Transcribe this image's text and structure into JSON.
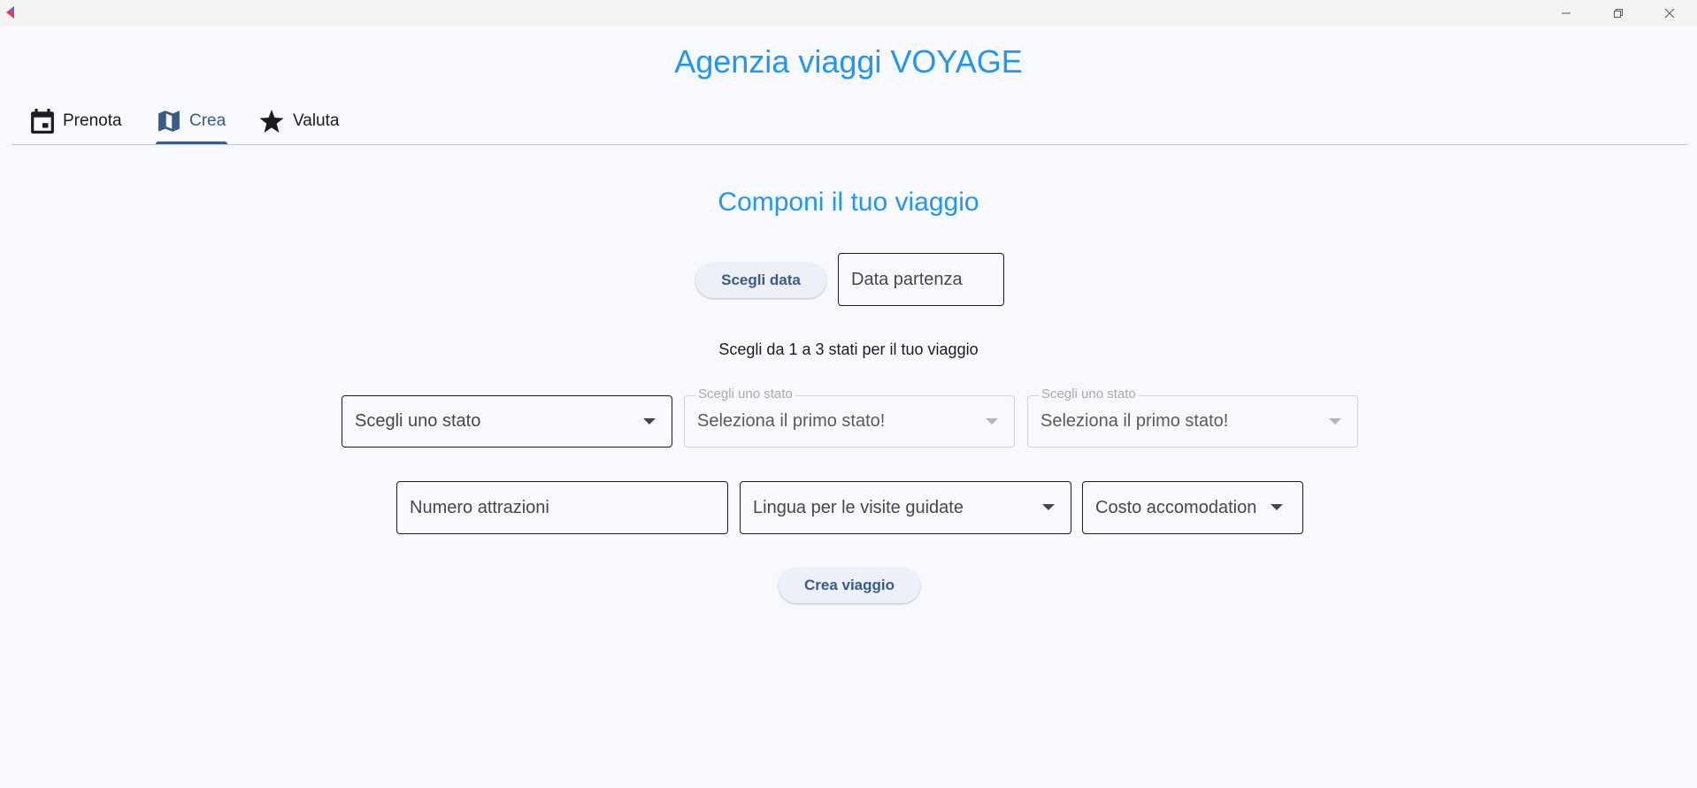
{
  "window": {
    "controls": {
      "minimize_icon": "minimize-icon",
      "maximize_icon": "restore-icon",
      "close_icon": "close-icon"
    }
  },
  "header": {
    "title": "Agenzia viaggi VOYAGE"
  },
  "tabs": [
    {
      "label": "Prenota",
      "icon": "calendar-icon",
      "active": false
    },
    {
      "label": "Crea",
      "icon": "map-icon",
      "active": true
    },
    {
      "label": "Valuta",
      "icon": "star-icon",
      "active": false
    }
  ],
  "form": {
    "title": "Componi il tuo viaggio",
    "date_button": "Scegli data",
    "date_field_placeholder": "Data partenza",
    "instructions": "Scegli da 1 a 3 stati per il tuo viaggio",
    "state_select_1": {
      "value": "Scegli uno stato"
    },
    "state_select_2": {
      "label": "Scegli uno stato",
      "value": "Seleziona il primo stato!"
    },
    "state_select_3": {
      "label": "Scegli uno stato",
      "value": "Seleziona il primo stato!"
    },
    "attractions_field_placeholder": "Numero attrazioni",
    "language_select": {
      "value": "Lingua per le visite guidate"
    },
    "cost_select": {
      "value": "Costo accomodation"
    },
    "submit_button": "Crea viaggio"
  },
  "colors": {
    "accent_title": "#2196f3",
    "primary": "#3a5a8c",
    "background": "#f8f9fe"
  }
}
